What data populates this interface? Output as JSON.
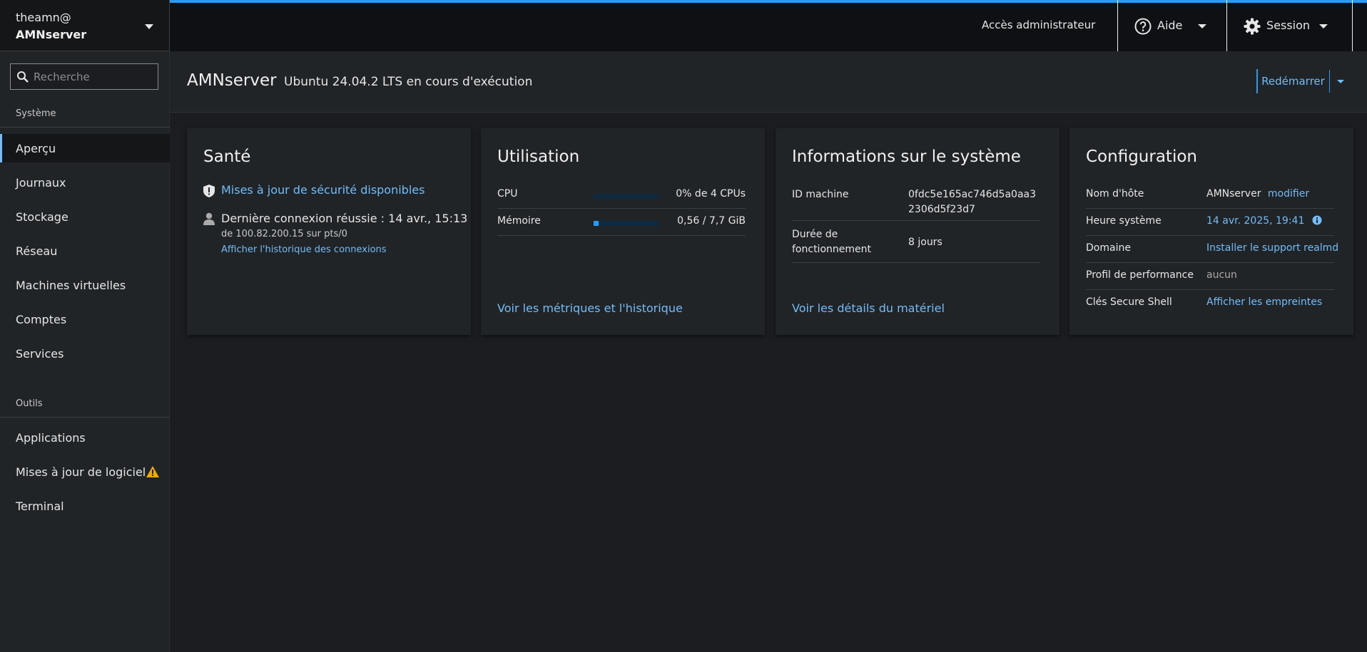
{
  "host_switcher": {
    "user": "theamn@",
    "host": "AMNserver"
  },
  "search": {
    "placeholder": "Recherche"
  },
  "sidebar": {
    "system_section": "Système",
    "system_items": [
      {
        "label": "Aperçu",
        "active": true
      },
      {
        "label": "Journaux"
      },
      {
        "label": "Stockage"
      },
      {
        "label": "Réseau"
      },
      {
        "label": "Machines virtuelles"
      },
      {
        "label": "Comptes"
      },
      {
        "label": "Services"
      }
    ],
    "tools_section": "Outils",
    "tool_items": [
      {
        "label": "Applications"
      },
      {
        "label": "Mises à jour de logiciel",
        "icon": "warning-icon"
      },
      {
        "label": "Terminal"
      }
    ]
  },
  "topbar": {
    "admin_access": "Accès administrateur",
    "help": "Aide",
    "session": "Session"
  },
  "page": {
    "title": "AMNserver",
    "subtitle": "Ubuntu 24.04.2 LTS en cours d'exécution",
    "restart": "Redémarrer"
  },
  "health": {
    "title": "Santé",
    "updates_link": "Mises à jour de sécurité disponibles",
    "last_login": "Dernière connexion réussie : 14 avr., 15:13",
    "login_from": "de 100.82.200.15 sur pts/0",
    "history_link": "Afficher l'historique des connexions"
  },
  "usage": {
    "title": "Utilisation",
    "rows": [
      {
        "name": "CPU",
        "fraction": 0.0,
        "value": "0% de 4 CPUs"
      },
      {
        "name": "Mémoire",
        "fraction": 0.073,
        "value": "0,56 / 7,7 GiB"
      }
    ],
    "metrics_link": "Voir les métriques et l'historique"
  },
  "sysinfo": {
    "title": "Informations sur le système",
    "machine_id_label": "ID machine",
    "machine_id": "0fdc5e165ac746d5a0aa32306d5f23d7",
    "uptime_label": "Durée de fonctionnement",
    "uptime": "8 jours",
    "hardware_link": "Voir les détails du matériel"
  },
  "config": {
    "title": "Configuration",
    "hostname_label": "Nom d'hôte",
    "hostname": "AMNserver",
    "hostname_edit": "modifier",
    "time_label": "Heure système",
    "time": "14 avr. 2025, 19:41",
    "domain_label": "Domaine",
    "domain_link": "Installer le support realmd",
    "perf_label": "Profil de performance",
    "perf": "aucun",
    "ssh_label": "Clés Secure Shell",
    "ssh_link": "Afficher les empreintes"
  },
  "colors": {
    "accent": "#2b9af3",
    "link": "#73bcf7",
    "warning": "#f0ab00"
  }
}
